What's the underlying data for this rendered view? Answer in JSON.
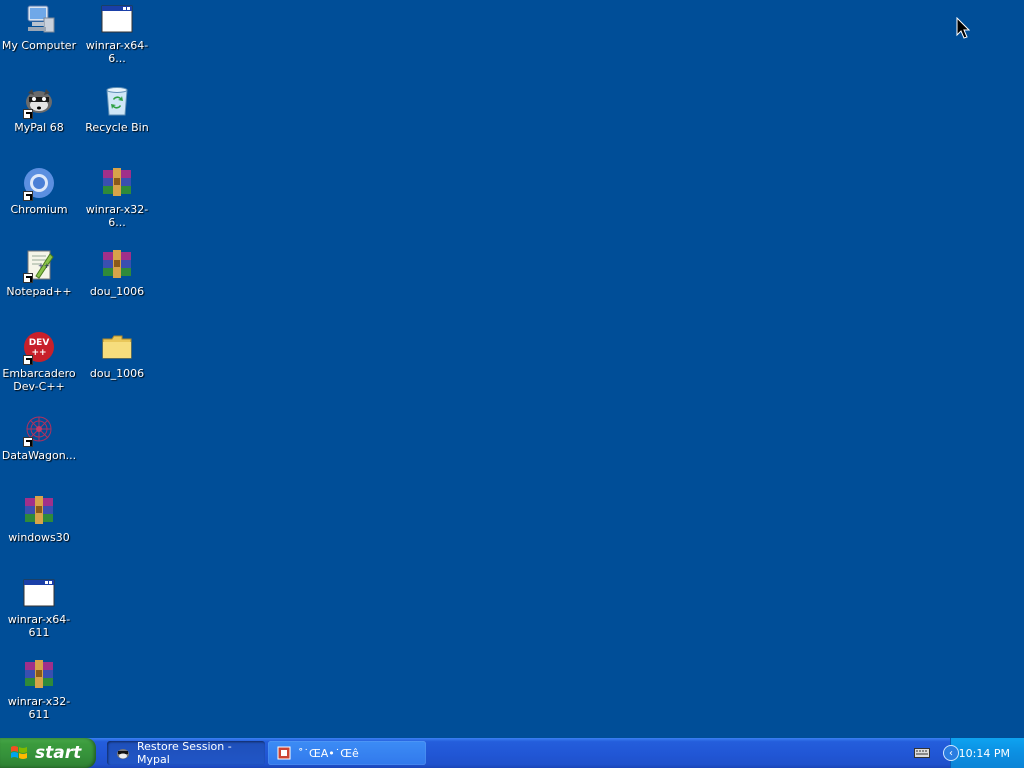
{
  "desktop": {
    "background_color": "#004e98",
    "icons": [
      {
        "label": "My Computer",
        "icon": "my-computer-icon",
        "shortcut": false
      },
      {
        "label": "winrar-x64-6...",
        "icon": "window-app-icon",
        "shortcut": false
      },
      {
        "label": "MyPal 68",
        "icon": "mypal-raccoon-icon",
        "shortcut": true
      },
      {
        "label": "Recycle Bin",
        "icon": "recycle-bin-icon",
        "shortcut": false
      },
      {
        "label": "Chromium",
        "icon": "chromium-icon",
        "shortcut": true
      },
      {
        "label": "winrar-x32-6...",
        "icon": "winrar-archive-icon",
        "shortcut": false
      },
      {
        "label": "Notepad++",
        "icon": "notepad-plus-plus-icon",
        "shortcut": true
      },
      {
        "label": "dou_1006",
        "icon": "winrar-archive-icon",
        "shortcut": false
      },
      {
        "label": "Embarcadero Dev-C++",
        "icon": "devcpp-icon",
        "shortcut": true
      },
      {
        "label": "dou_1006",
        "icon": "folder-icon",
        "shortcut": false
      },
      {
        "label": "DataWagon...",
        "icon": "datawagon-icon",
        "shortcut": true
      },
      {
        "label": "windows30",
        "icon": "winrar-archive-icon",
        "shortcut": false
      },
      {
        "label": "winrar-x64-611",
        "icon": "window-app-icon",
        "shortcut": false
      },
      {
        "label": "winrar-x32-611",
        "icon": "winrar-archive-icon",
        "shortcut": false
      }
    ]
  },
  "taskbar": {
    "start_label": "start",
    "tasks": [
      {
        "label": "Restore Session - Mypal",
        "icon": "mypal-raccoon-icon",
        "active": true
      },
      {
        "label": "˚˙ŒA•˙Œê",
        "icon": "app-game-icon",
        "active": false
      }
    ],
    "clock": "10:14 PM"
  }
}
